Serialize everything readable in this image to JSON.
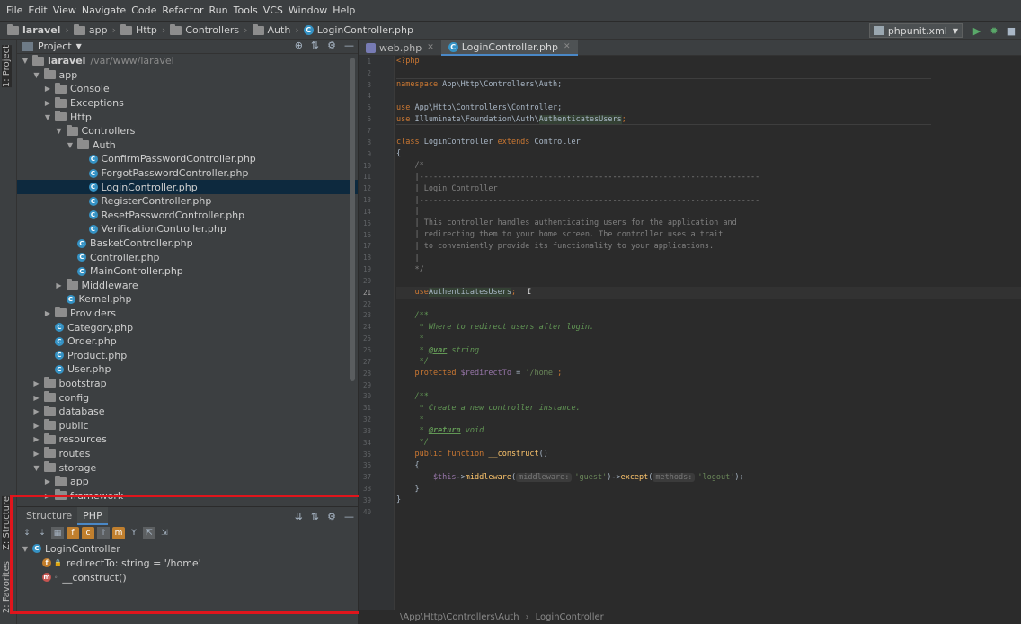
{
  "menu": [
    "File",
    "Edit",
    "View",
    "Navigate",
    "Code",
    "Refactor",
    "Run",
    "Tools",
    "VCS",
    "Window",
    "Help"
  ],
  "navbar": {
    "crumbs": [
      "laravel",
      "app",
      "Http",
      "Controllers",
      "Auth",
      "LoginController.php"
    ],
    "run_config": "phpunit.xml"
  },
  "left_stripe": {
    "project_tab": "1: Project",
    "structure_tab": "Z: Structure",
    "favorites_tab": "2: Favorites"
  },
  "project_panel": {
    "title": "Project",
    "tree": [
      {
        "label": "laravel",
        "hint": "/var/www/laravel",
        "depth": 0,
        "type": "folder",
        "open": true
      },
      {
        "label": "app",
        "depth": 1,
        "type": "folder",
        "open": true
      },
      {
        "label": "Console",
        "depth": 2,
        "type": "folder",
        "open": false
      },
      {
        "label": "Exceptions",
        "depth": 2,
        "type": "folder",
        "open": false
      },
      {
        "label": "Http",
        "depth": 2,
        "type": "folder",
        "open": true
      },
      {
        "label": "Controllers",
        "depth": 3,
        "type": "folder",
        "open": true
      },
      {
        "label": "Auth",
        "depth": 4,
        "type": "folder",
        "open": true
      },
      {
        "label": "ConfirmPasswordController.php",
        "depth": 5,
        "type": "class"
      },
      {
        "label": "ForgotPasswordController.php",
        "depth": 5,
        "type": "class"
      },
      {
        "label": "LoginController.php",
        "depth": 5,
        "type": "class",
        "selected": true
      },
      {
        "label": "RegisterController.php",
        "depth": 5,
        "type": "class"
      },
      {
        "label": "ResetPasswordController.php",
        "depth": 5,
        "type": "class"
      },
      {
        "label": "VerificationController.php",
        "depth": 5,
        "type": "class"
      },
      {
        "label": "BasketController.php",
        "depth": 4,
        "type": "class"
      },
      {
        "label": "Controller.php",
        "depth": 4,
        "type": "class"
      },
      {
        "label": "MainController.php",
        "depth": 4,
        "type": "class"
      },
      {
        "label": "Middleware",
        "depth": 3,
        "type": "folder",
        "open": false
      },
      {
        "label": "Kernel.php",
        "depth": 3,
        "type": "class"
      },
      {
        "label": "Providers",
        "depth": 2,
        "type": "folder",
        "open": false
      },
      {
        "label": "Category.php",
        "depth": 2,
        "type": "class"
      },
      {
        "label": "Order.php",
        "depth": 2,
        "type": "class"
      },
      {
        "label": "Product.php",
        "depth": 2,
        "type": "class"
      },
      {
        "label": "User.php",
        "depth": 2,
        "type": "class"
      },
      {
        "label": "bootstrap",
        "depth": 1,
        "type": "folder",
        "open": false
      },
      {
        "label": "config",
        "depth": 1,
        "type": "folder",
        "open": false
      },
      {
        "label": "database",
        "depth": 1,
        "type": "folder",
        "open": false
      },
      {
        "label": "public",
        "depth": 1,
        "type": "folder",
        "open": false
      },
      {
        "label": "resources",
        "depth": 1,
        "type": "folder",
        "open": false
      },
      {
        "label": "routes",
        "depth": 1,
        "type": "folder",
        "open": false
      },
      {
        "label": "storage",
        "depth": 1,
        "type": "folder",
        "open": true
      },
      {
        "label": "app",
        "depth": 2,
        "type": "folder",
        "open": false
      },
      {
        "label": "framework",
        "depth": 2,
        "type": "folder",
        "open": false
      }
    ]
  },
  "structure_panel": {
    "tabs": [
      "Structure",
      "PHP"
    ],
    "active_tab": "PHP",
    "items": [
      {
        "label": "LoginController",
        "kind": "class",
        "depth": 0
      },
      {
        "label": "redirectTo: string = '/home'",
        "kind": "field",
        "depth": 1
      },
      {
        "label": "__construct()",
        "kind": "method",
        "depth": 1
      }
    ]
  },
  "editor": {
    "tabs": [
      {
        "label": "web.php",
        "active": false
      },
      {
        "label": "LoginController.php",
        "active": true
      }
    ],
    "lines": [
      "1",
      "2",
      "3",
      "4",
      "5",
      "6",
      "7",
      "8",
      "9",
      "10",
      "11",
      "12",
      "13",
      "14",
      "15",
      "16",
      "17",
      "18",
      "19",
      "20",
      "21",
      "22",
      "23",
      "24",
      "25",
      "26",
      "27",
      "28",
      "29",
      "30",
      "31",
      "32",
      "33",
      "34",
      "35",
      "36",
      "37",
      "38",
      "39",
      "40"
    ],
    "code": {
      "l1": "<?php",
      "l3_kw": "namespace",
      "l3_rest": " App\\Http\\Controllers\\Auth;",
      "l5_kw": "use",
      "l5_rest": " App\\Http\\Controllers\\Controller;",
      "l6_kw": "use",
      "l6_rest": " Illuminate\\Foundation\\Auth\\",
      "l6_hl": "AuthenticatesUsers",
      "l6_end": ";",
      "l8_kw1": "class",
      "l8_name": " LoginController ",
      "l8_kw2": "extends",
      "l8_parent": " Controller",
      "l9": "{",
      "l10": "    /*",
      "l11": "    |--------------------------------------------------------------------------",
      "l12": "    | Login Controller",
      "l13": "    |--------------------------------------------------------------------------",
      "l14": "    |",
      "l15": "    | This controller handles authenticating users for the application and",
      "l16": "    | redirecting them to your home screen. The controller uses a trait",
      "l17": "    | to conveniently provide its functionality to your applications.",
      "l18": "    |",
      "l19": "    */",
      "l21_kw": "    use",
      "l21_hl": "AuthenticatesUsers",
      "l21_end": ";",
      "l23": "    /**",
      "l24": "     * Where to redirect users after login.",
      "l25": "     *",
      "l26_pre": "     * ",
      "l26_tag": "@var",
      "l26_post": " string",
      "l27": "     */",
      "l28_kw": "    protected",
      "l28_var": " $redirectTo",
      "l28_eq": " = ",
      "l28_str": "'/home'",
      "l28_end": ";",
      "l30": "    /**",
      "l31": "     * Create a new controller instance.",
      "l32": "     *",
      "l33_pre": "     * ",
      "l33_tag": "@return",
      "l33_post": " void",
      "l34": "     */",
      "l35_kw": "    public function",
      "l35_fn": " __construct",
      "l35_end": "()",
      "l36": "    {",
      "l37_var": "        $this",
      "l37_arrow": "->",
      "l37_fn1": "middleware",
      "l37_p1": "(",
      "l37_hint1": "middleware:",
      "l37_s1": "'guest'",
      "l37_p2": ")->",
      "l37_fn2": "except",
      "l37_p3": "(",
      "l37_hint2": "methods:",
      "l37_s2": "'logout'",
      "l37_end": ");",
      "l38": "    }",
      "l39": "}"
    }
  },
  "editor_crumb": [
    "\\App\\Http\\Controllers\\Auth",
    "LoginController"
  ]
}
